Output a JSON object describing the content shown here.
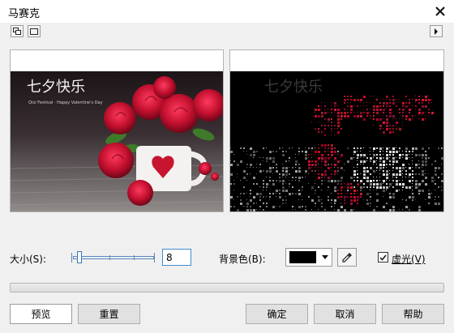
{
  "window": {
    "title": "马赛克"
  },
  "preview": {
    "original": {
      "caption": "七夕快乐",
      "subcaption": "Qixi Festival · Happy Valentine's Day"
    },
    "result": {
      "caption": "七夕快乐"
    }
  },
  "controls": {
    "size_label": "大小(S):",
    "size_value": "8",
    "bg_color_label": "背景色(B):",
    "bg_color": "#000000",
    "vignette_label": "虚光(V)",
    "vignette_checked": true
  },
  "buttons": {
    "preview": "预览",
    "reset": "重置",
    "ok": "确定",
    "cancel": "取消",
    "help": "帮助"
  },
  "icons": {
    "close": "close-icon",
    "view_split": "split-view-icon",
    "view_single": "single-view-icon",
    "expand": "play-right-icon",
    "eyedropper": "eyedropper-icon"
  }
}
